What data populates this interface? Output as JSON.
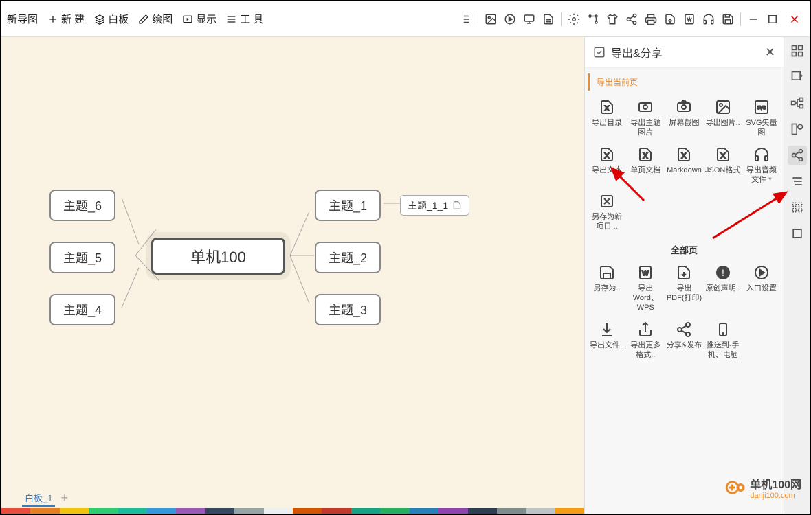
{
  "toolbar": {
    "title": "新导图",
    "new": "新 建",
    "whiteboard": "白板",
    "draw": "绘图",
    "display": "显示",
    "tools": "工 具"
  },
  "mindmap": {
    "central": "单机100",
    "t1": "主题_1",
    "t2": "主题_2",
    "t3": "主题_3",
    "t4": "主题_4",
    "t5": "主题_5",
    "t6": "主题_6",
    "t1_1": "主题_1_1"
  },
  "tabs": {
    "tab1": "白板_1"
  },
  "panel": {
    "title": "导出&分享",
    "section1": "导出当前页",
    "allpage": "全部页",
    "items": {
      "catalog": "导出目录",
      "topic_img": "导出主题图片",
      "screenshot": "屏幕截图",
      "export_img": "导出图片..",
      "svg": "SVG矢量图",
      "text": "导出文本",
      "single_doc": "单页文档",
      "markdown": "Markdown",
      "json": "JSON格式",
      "audio": "导出音频文件 *",
      "save_new": "另存为新项目 ..",
      "save_as": "另存为..",
      "word": "导出Word、WPS",
      "pdf": "导出PDF(打印)",
      "original": "原创声明..",
      "entry": "入口设置",
      "file": "导出文件..",
      "more": "导出更多格式..",
      "share": "分享&发布",
      "push": "推送到-手机、电脑"
    }
  },
  "watermark": {
    "name": "单机100网",
    "url": "danji100.com"
  }
}
